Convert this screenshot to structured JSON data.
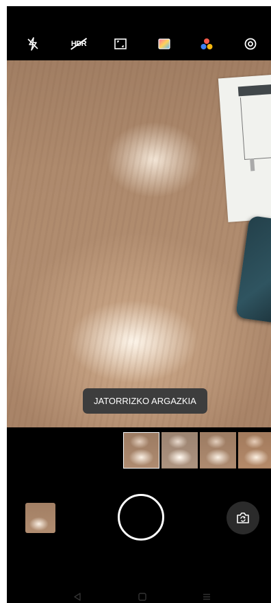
{
  "top_bar": {
    "icons": [
      "flash-off-icon",
      "hdr-off-icon",
      "aspect-ratio-icon",
      "filter-icon",
      "color-mode-icon",
      "settings-icon"
    ],
    "hdr_label": "HDR"
  },
  "viewfinder": {
    "toast_text": "JATORRIZKO ARGAZKIA"
  },
  "filter_strip": {
    "count_visible": 4,
    "selected_index": 0
  },
  "controls": {
    "shutter": "shutter-button",
    "switch_camera": "switch-camera-icon",
    "gallery": "gallery-thumbnail"
  },
  "nav_bar": {
    "icons": [
      "back-icon",
      "home-icon",
      "menu-icon"
    ]
  },
  "colors": {
    "background": "#000000",
    "toast_bg": "#3d3d3d",
    "icon": "#ffffff",
    "nav_icon": "#333333"
  }
}
